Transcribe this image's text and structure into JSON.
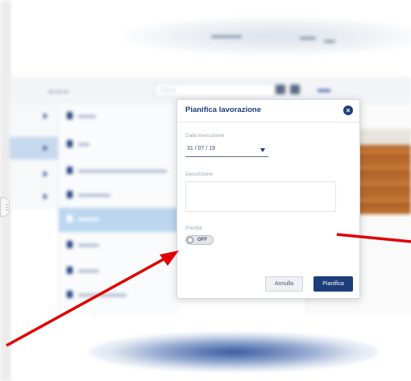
{
  "app": {
    "toolbar": {
      "search_placeholder": "Cerca"
    }
  },
  "dialog": {
    "title": "Pianifica lavorazione",
    "date_label": "Data esecuzione",
    "date_value": "31 / 07 / 19",
    "description_label": "Descrizione",
    "description_value": "",
    "priority_label": "Priorità",
    "priority_state": "OFF",
    "cancel_label": "Annulla",
    "submit_label": "Pianifica"
  },
  "colors": {
    "accent": "#1c3d7a",
    "annotation_arrow": "#e00000",
    "selected_row": "#bcd6f0"
  },
  "icons": [
    "close-icon",
    "chevron-down-icon",
    "file-icon",
    "folder-arrow-icon",
    "grip-icon"
  ]
}
